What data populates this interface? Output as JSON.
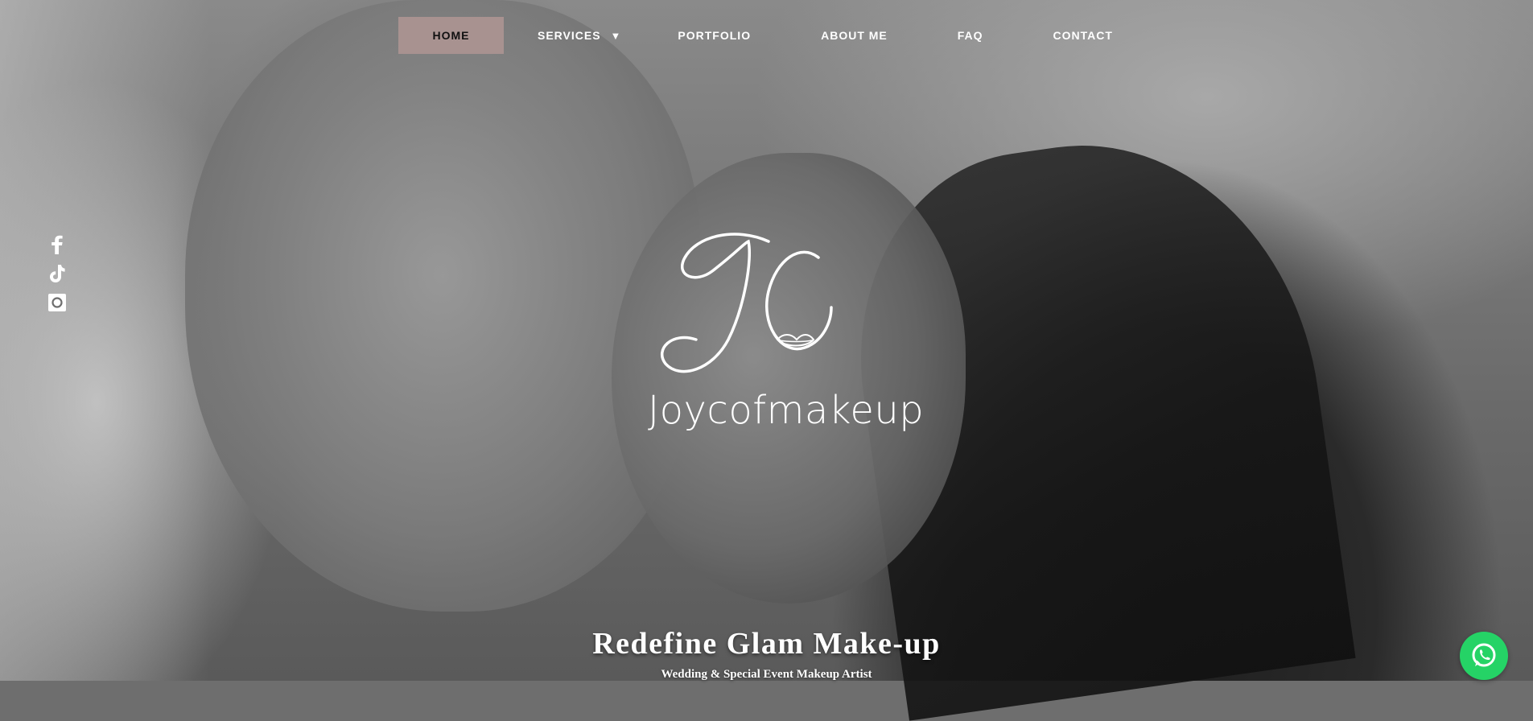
{
  "nav": {
    "items": [
      {
        "label": "HOME",
        "active": true
      },
      {
        "label": "SERVICES",
        "has_dropdown": true,
        "dropdown_icon": "triangle-down-icon"
      },
      {
        "label": "PORTFOLIO"
      },
      {
        "label": "ABOUT ME"
      },
      {
        "label": "FAQ"
      },
      {
        "label": "CONTACT"
      }
    ],
    "active_color": "#a89290"
  },
  "social": {
    "icons": [
      "facebook-icon",
      "tiktok-icon",
      "instagram-icon"
    ]
  },
  "logo": {
    "monogram": "JC",
    "brand": "Joycofmakeup"
  },
  "hero": {
    "headline": "Redefine Glam Make-up",
    "subline": "Wedding & Special Event Makeup Artist"
  },
  "whatsapp": {
    "icon": "whatsapp-icon",
    "color": "#25d366"
  }
}
